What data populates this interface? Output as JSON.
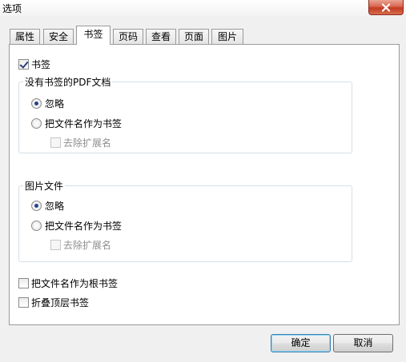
{
  "window": {
    "title": "选项",
    "close_icon": "close-x-icon"
  },
  "tabs": [
    {
      "label": "属性",
      "active": false
    },
    {
      "label": "安全",
      "active": false
    },
    {
      "label": "书签",
      "active": true
    },
    {
      "label": "页码",
      "active": false
    },
    {
      "label": "查看",
      "active": false
    },
    {
      "label": "页面",
      "active": false
    },
    {
      "label": "图片",
      "active": false
    }
  ],
  "bookmarks": {
    "enable_label": "书签",
    "enable_checked": true,
    "pdf_group": {
      "title": "没有书签的PDF文档",
      "ignore_label": "忽略",
      "use_filename_label": "把文件名作为书签",
      "remove_ext_label": "去除扩展名",
      "selected": "ignore"
    },
    "image_group": {
      "title": "图片文件",
      "ignore_label": "忽略",
      "use_filename_label": "把文件名作为书签",
      "remove_ext_label": "去除扩展名",
      "selected": "ignore"
    },
    "root_bookmark_label": "把文件名作为根书签",
    "root_bookmark_checked": false,
    "collapse_label": "折叠顶层书签",
    "collapse_checked": false
  },
  "buttons": {
    "ok_label": "确定",
    "cancel_label": "取消"
  }
}
